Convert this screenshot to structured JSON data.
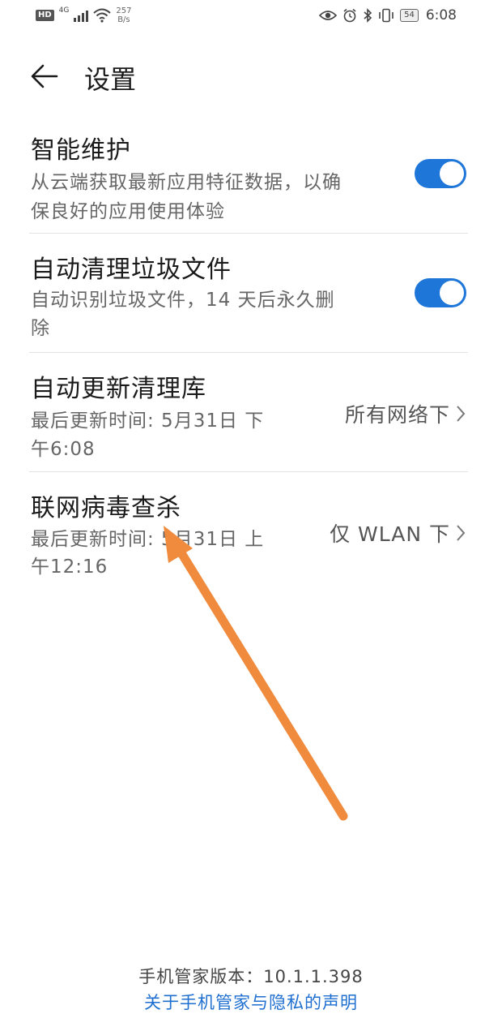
{
  "status_bar": {
    "hd_badge": "HD",
    "network_type": "4G",
    "net_speed_value": "257",
    "net_speed_unit": "B/s",
    "battery_label": "54",
    "time": "6:08"
  },
  "header": {
    "title": "设置"
  },
  "settings": [
    {
      "title": "智能维护",
      "desc_line1": "从云端获取最新应用特征数据，以确",
      "desc_line2": "保良好的应用使用体验",
      "toggle_on": true
    },
    {
      "title": "自动清理垃圾文件",
      "desc_line1": "自动识别垃圾文件，14 天后永久删",
      "desc_line2": "除",
      "toggle_on": true
    },
    {
      "title": "自动更新清理库",
      "desc_line1": "最后更新时间: 5月31日 下",
      "desc_line2": "午6:08",
      "value": "所有网络下"
    },
    {
      "title": "联网病毒查杀",
      "desc_line1": "最后更新时间: 5月31日 上",
      "desc_line2": "午12:16",
      "value": "仅 WLAN 下"
    }
  ],
  "footer": {
    "version_text": "手机管家版本：10.1.1.398",
    "privacy_link": "关于手机管家与隐私的声明"
  },
  "colors": {
    "accent": "#1e76d9",
    "link": "#1e6fd0",
    "annotation_arrow": "#f08a3c"
  },
  "icons": {
    "back": "arrow-left-icon",
    "chevron": "chevron-right-icon",
    "eye": "eye-icon",
    "alarm": "alarm-clock-icon",
    "bluetooth": "bluetooth-icon",
    "vibrate": "vibrate-icon",
    "wifi": "wifi-icon",
    "signal": "cell-signal-icon"
  }
}
